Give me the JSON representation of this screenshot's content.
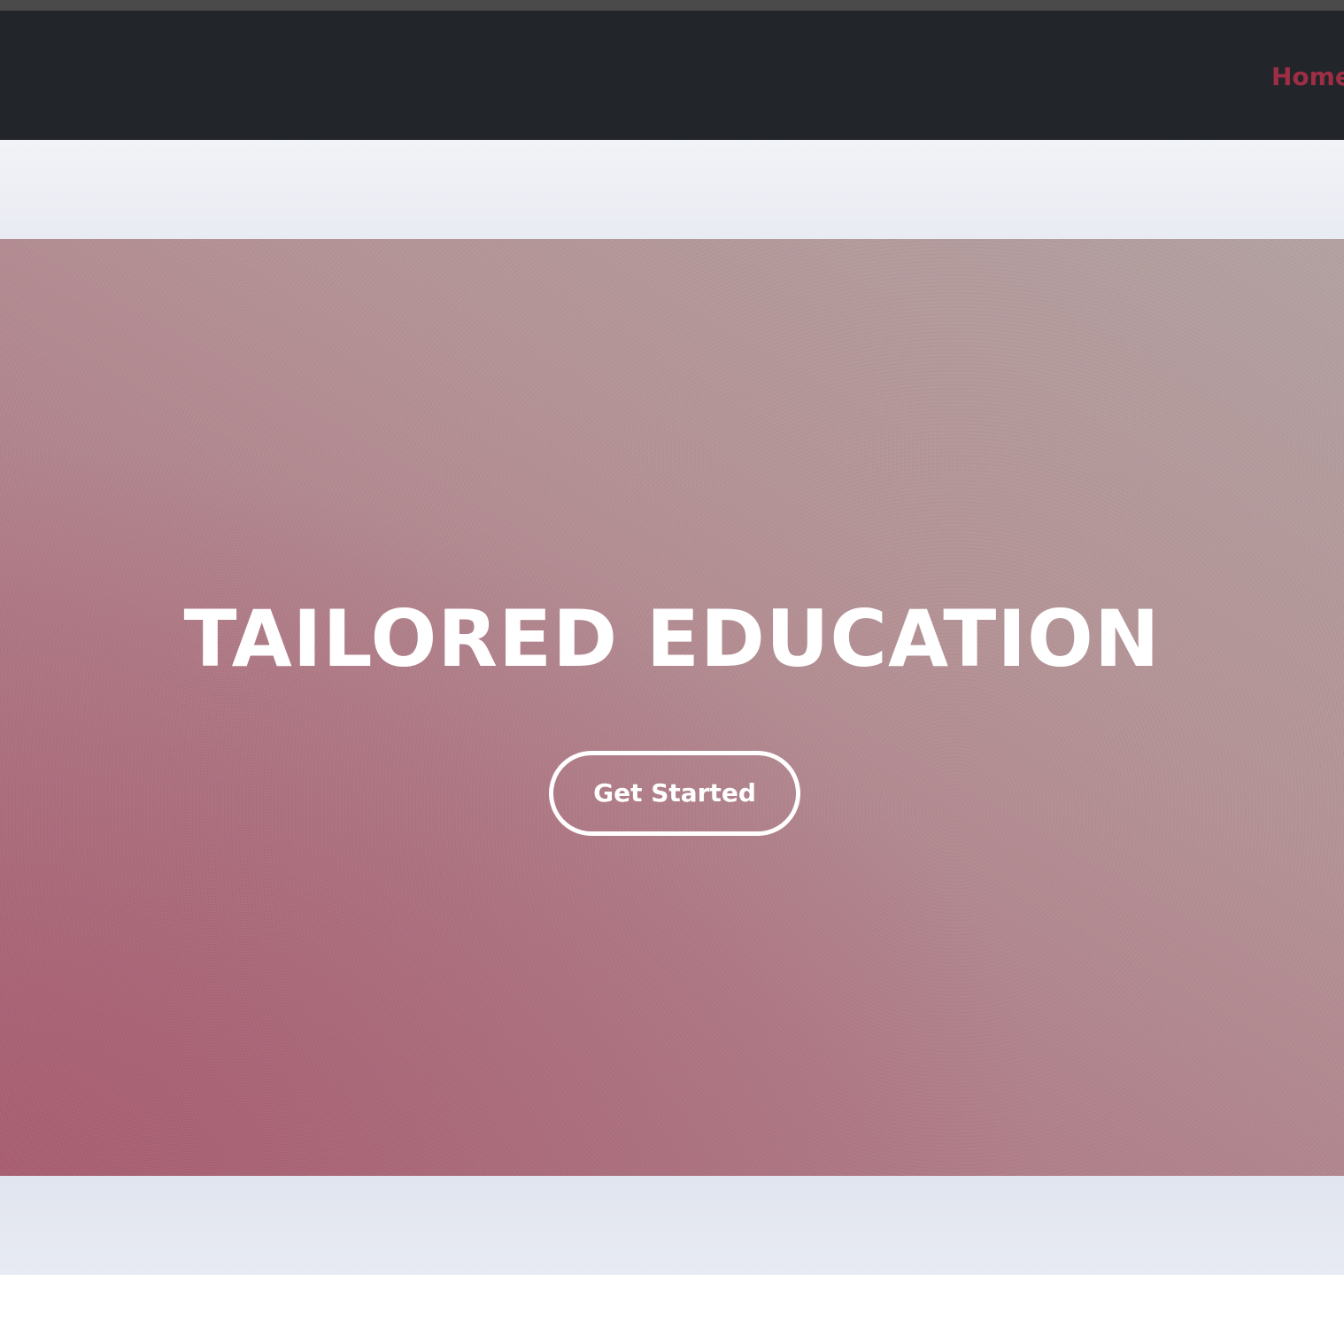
{
  "nav": {
    "home_label": "Home",
    "active_color": "#9e2e45"
  },
  "hero": {
    "title": "TAILORED EDUCATION",
    "cta_label": "Get Started"
  },
  "colors": {
    "navbar_bg": "#222529",
    "hero_gradient": [
      "#a9707e",
      "#b3a1a1"
    ],
    "accent": "#b3344e",
    "band_bg": "#eef0f6"
  }
}
